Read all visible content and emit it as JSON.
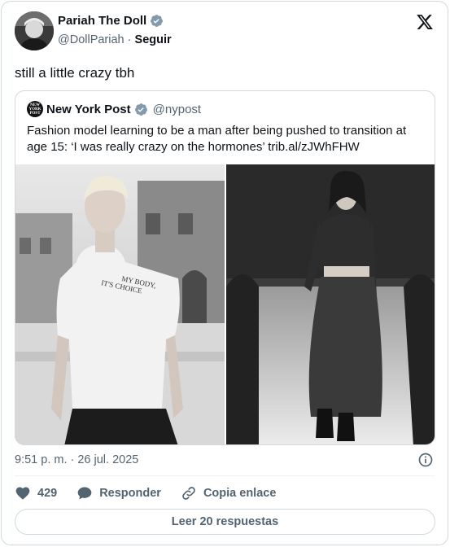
{
  "author": {
    "name": "Pariah The Doll",
    "handle": "@DollPariah",
    "separator": "·",
    "follow_label": "Seguir"
  },
  "tweet": {
    "text": "still a little crazy tbh"
  },
  "quoted": {
    "name": "New York Post",
    "handle": "@nypost",
    "avatar_text": "NEW YORK POST",
    "text": "Fashion model learning to be a man after being pushed to transition at age 15: ‘I was really crazy on the hormones’ trib.al/zJWhFHW",
    "shirt_text_1": "MY BODY,",
    "shirt_text_2": "IT'S CHOICE"
  },
  "meta": {
    "timestamp": "9:51 p. m. · 26 jul. 2025"
  },
  "actions": {
    "likes": "429",
    "reply_label": "Responder",
    "copy_label": "Copia enlace"
  },
  "read_replies": "Leer 20 respuestas",
  "colors": {
    "verified": "#829aab",
    "secondary_text": "#536471",
    "border": "#cfd9de"
  }
}
